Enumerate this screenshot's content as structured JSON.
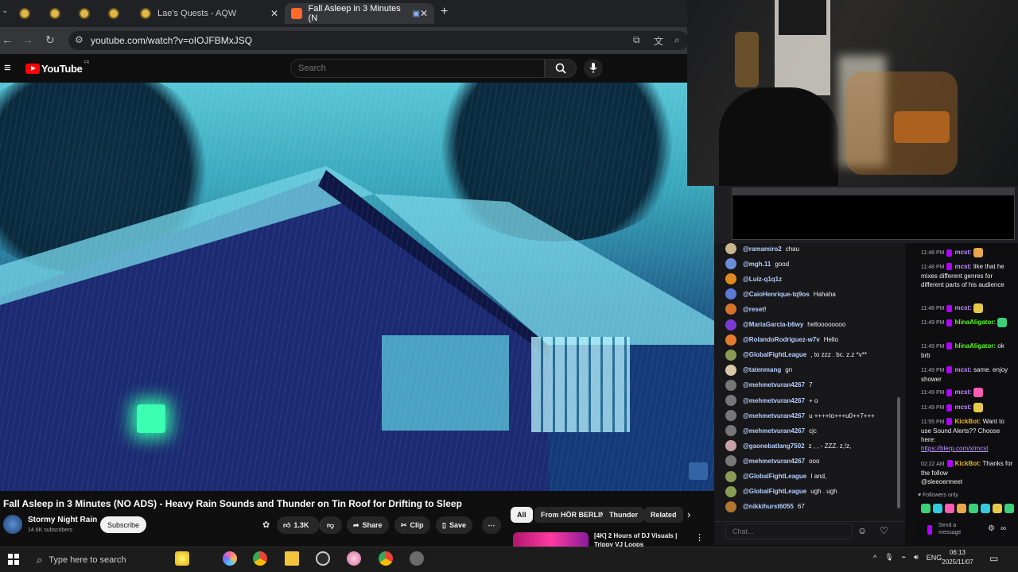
{
  "browser": {
    "tabs": [
      {
        "label": ""
      },
      {
        "label": ""
      },
      {
        "label": ""
      },
      {
        "label": ""
      },
      {
        "label": "Lae's Quests - AQW"
      },
      {
        "label": "Fall Asleep in 3 Minutes (N"
      }
    ],
    "new_tab": "+",
    "url": "youtube.com/watch?v=oIOJFBMxJSQ"
  },
  "youtube": {
    "logo_text": "YouTube",
    "logo_region": "FR",
    "search_placeholder": "Search",
    "video": {
      "title": "Fall Asleep in 3 Minutes (NO ADS) - Heavy Rain Sounds and Thunder on Tin Roof for Drifting to Sleep",
      "channel": "Stormy Night Rain",
      "subscribers": "14.6K subscribers",
      "subscribe_label": "Subscribe",
      "likes": "1.3K",
      "share_label": "Share",
      "clip_label": "Clip",
      "save_label": "Save"
    },
    "chips": [
      "All",
      "From HÖR BERLIN",
      "Thunder",
      "Related"
    ],
    "recommendation": {
      "title": "[4K] 2 Hours of DJ Visuals | Trippy VJ Loops"
    }
  },
  "chat_left": {
    "messages": [
      {
        "user": "@ramamiro2",
        "msg": "chau",
        "color": "#c7b78a"
      },
      {
        "user": "@mgh.11",
        "msg": "good",
        "color": "#6b8cd8"
      },
      {
        "user": "@Luiz-q1q1z",
        "msg": "",
        "color": "#e08a1e"
      },
      {
        "user": "@CaioHenrique-tq9os",
        "msg": "Hahaha",
        "color": "#5b7ad6"
      },
      {
        "user": "@reset!",
        "msg": "",
        "color": "#d4742a"
      },
      {
        "user": "@MariaGarcia-b6wy",
        "msg": "helloooooooo",
        "color": "#7a3bd0"
      },
      {
        "user": "@RolandoRodriguez-w7v",
        "msg": "Hello",
        "color": "#e07b2c"
      },
      {
        "user": "@GlobalFightLeague",
        "msg": ", to zzz . bc. z.z *v**",
        "color": "#8a9b55"
      },
      {
        "user": "@tatenmang",
        "msg": "gn",
        "color": "#d9c9a8"
      },
      {
        "user": "@mehmetvuran4267",
        "msg": "7",
        "color": "#777"
      },
      {
        "user": "@mehmetvuran4267",
        "msg": "+ o",
        "color": "#777"
      },
      {
        "user": "@mehmetvuran4267",
        "msg": "u ++++to+++u0++7+++",
        "color": "#777"
      },
      {
        "user": "@mehmetvuran4267",
        "msg": "cjc",
        "color": "#777"
      },
      {
        "user": "@gaonebatlang7502",
        "msg": "z , , - ZZZ. z,!z,",
        "color": "#c9a0a8"
      },
      {
        "user": "@mehmetvuran4267",
        "msg": "ooo",
        "color": "#777"
      },
      {
        "user": "@GlobalFightLeague",
        "msg": "I and,",
        "color": "#8a9b55"
      },
      {
        "user": "@GlobalFightLeague",
        "msg": "ugh . ugh",
        "color": "#8a9b55"
      },
      {
        "user": "@nikkihurst6055",
        "msg": "67",
        "color": "#b0752f"
      }
    ],
    "input_placeholder": "Chat..."
  },
  "chat_right": {
    "messages": [
      {
        "time": "11:48 PM",
        "user": "mcst:",
        "text": ""
      },
      {
        "time": "11:48 PM",
        "user": "mcst:",
        "text": "like that he mixes different genres for different parts of his audience"
      },
      {
        "time": "11:48 PM",
        "user": "mcst:",
        "text": ""
      },
      {
        "time": "11:49 PM",
        "user": "hlinaAligator:",
        "text": ""
      },
      {
        "time": "11:49 PM",
        "user": "hlinaAligator:",
        "text": "ok brb"
      },
      {
        "time": "11:49 PM",
        "user": "mcst:",
        "text": "same. enjoy shower"
      },
      {
        "time": "11:49 PM",
        "user": "mcst:",
        "text": ""
      },
      {
        "time": "11:49 PM",
        "user": "mcst:",
        "text": ""
      },
      {
        "time": "11:55 PM",
        "user": "KickBot:",
        "text": "Want to use Sound Alerts?? Choose here:",
        "link": "https://blerp.com/x/mcst"
      },
      {
        "time": "02:22 AM",
        "user": "KickBot:",
        "text": "Thanks for the follow",
        "mention": "@sleeoermeet"
      }
    ],
    "footer": "Followers only",
    "send_placeholder": "Send a message"
  },
  "taskbar": {
    "search_placeholder": "Type here to search",
    "language": "ENG",
    "time": "06:13",
    "date": "2025/11/07"
  },
  "colors": {
    "youtube_red": "#ff0000",
    "kick_purple": "#b200ff",
    "chat_link": "#bf94ff"
  }
}
